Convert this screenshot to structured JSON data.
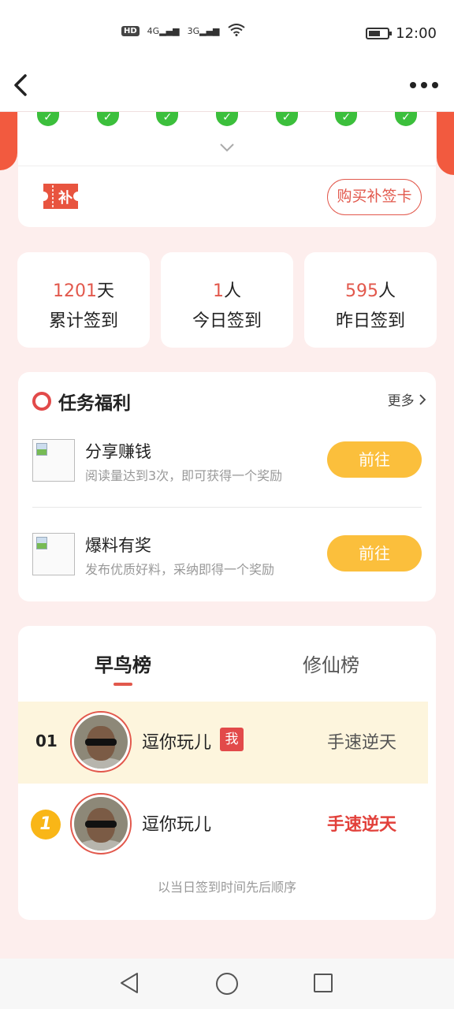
{
  "status_bar": {
    "hd": "HD",
    "net1": "4G",
    "net2": "3G",
    "time": "12:00"
  },
  "nav": {
    "back_icon": "chevron-left-icon",
    "more_icon": "more-dots-icon"
  },
  "sign": {
    "checks": [
      "✓",
      "✓",
      "✓",
      "✓",
      "✓",
      "✓",
      "✓"
    ],
    "buy_card_label": "购买补签卡",
    "ticket_label": "补"
  },
  "stats": [
    {
      "value": "1201",
      "unit": "天",
      "label": "累计签到"
    },
    {
      "value": "1",
      "unit": "人",
      "label": "今日签到"
    },
    {
      "value": "595",
      "unit": "人",
      "label": "昨日签到"
    }
  ],
  "tasks": {
    "title": "任务福利",
    "more_label": "更多",
    "items": [
      {
        "name": "分享赚钱",
        "desc": "阅读量达到3次，即可获得一个奖励",
        "button": "前往"
      },
      {
        "name": "爆料有奖",
        "desc": "发布优质好料，采纳即得一个奖励",
        "button": "前往"
      }
    ]
  },
  "ranking": {
    "tabs": [
      "早鸟榜",
      "修仙榜"
    ],
    "rows": [
      {
        "rank": "01",
        "name": "逗你玩儿",
        "badge": "我",
        "title": "手速逆天"
      },
      {
        "rank": "1",
        "name": "逗你玩儿",
        "title": "手速逆天"
      }
    ],
    "footnote": "以当日签到时间先后顺序"
  },
  "colors": {
    "accent": "#e2584c",
    "button_yellow": "#fbbf3c",
    "check_green": "#3cbf3c",
    "background": "#fdeeed"
  }
}
